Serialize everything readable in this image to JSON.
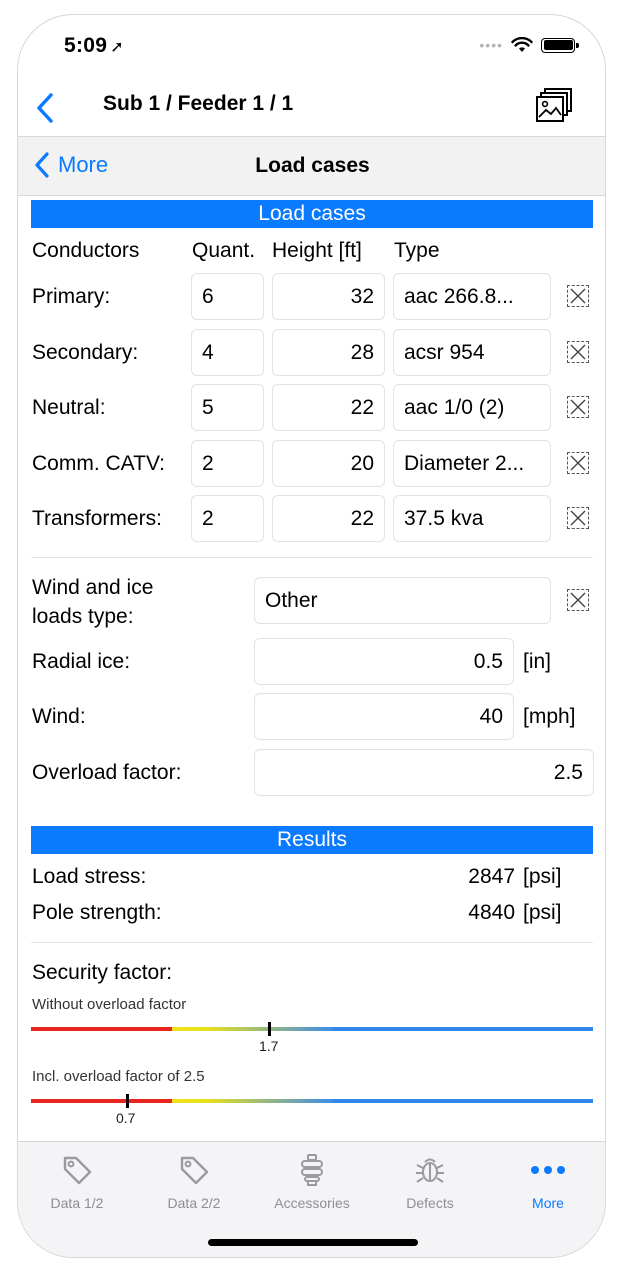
{
  "status": {
    "time": "5:09",
    "location_arrow": "➚"
  },
  "nav": {
    "title": "Sub 1 / Feeder 1 / 1",
    "back_label": "More",
    "page_title": "Load cases"
  },
  "load_cases": {
    "section_title": "Load cases",
    "headers": {
      "conductors": "Conductors",
      "quant": "Quant.",
      "height": "Height [ft]",
      "type": "Type"
    },
    "rows": [
      {
        "label": "Primary:",
        "quant": "6",
        "height": "32",
        "type": "aac 266.8..."
      },
      {
        "label": "Secondary:",
        "quant": "4",
        "height": "28",
        "type": "acsr 954"
      },
      {
        "label": "Neutral:",
        "quant": "5",
        "height": "22",
        "type": "aac 1/0 (2)"
      },
      {
        "label": "Comm. CATV:",
        "quant": "2",
        "height": "20",
        "type": "Diameter 2..."
      },
      {
        "label": "Transformers:",
        "quant": "2",
        "height": "22",
        "type": "37.5 kva"
      }
    ],
    "wind_ice_label_1": "Wind and ice",
    "wind_ice_label_2": "loads type:",
    "wind_ice_value": "Other",
    "radial_ice_label": "Radial ice:",
    "radial_ice_value": "0.5",
    "radial_ice_unit": "[in]",
    "wind_label": "Wind:",
    "wind_value": "40",
    "wind_unit": "[mph]",
    "overload_label": "Overload factor:",
    "overload_value": "2.5"
  },
  "results": {
    "section_title": "Results",
    "load_stress_label": "Load stress:",
    "load_stress_value": "2847",
    "load_stress_unit": "[psi]",
    "pole_strength_label": "Pole strength:",
    "pole_strength_value": "4840",
    "pole_strength_unit": "[psi]",
    "security_label": "Security factor:",
    "without_label": "Without overload factor",
    "without_value": "1.7",
    "incl_label": "Incl. overload factor of 2.5",
    "incl_value": "0.7"
  },
  "tabs": [
    {
      "label": "Data 1/2",
      "icon": "tag-icon"
    },
    {
      "label": "Data 2/2",
      "icon": "tag-icon"
    },
    {
      "label": "Accessories",
      "icon": "insulator-icon"
    },
    {
      "label": "Defects",
      "icon": "bug-icon"
    },
    {
      "label": "More",
      "icon": "ellipsis-icon"
    }
  ],
  "colors": {
    "accent": "#0a7aff",
    "low": "#e8251e",
    "mid": "#f0e21a",
    "high": "#2f88e8"
  }
}
